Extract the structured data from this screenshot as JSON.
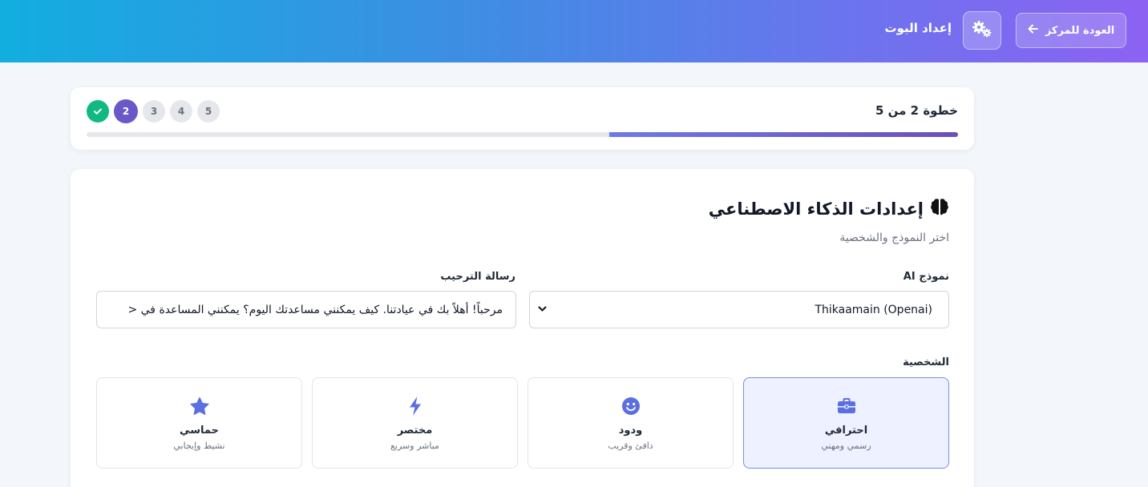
{
  "header": {
    "back_label": "العودة للمركز",
    "title": "إعداد البوت",
    "back_icon": "arrow-right-icon",
    "settings_icon": "gears-icon"
  },
  "progress": {
    "step_text": "خطوة 2 من 5",
    "current_step": 2,
    "total_steps": 5,
    "fraction": 0.4,
    "steps": [
      "✓",
      "2",
      "3",
      "4",
      "5"
    ]
  },
  "ai_settings": {
    "title": "إعدادات الذكاء الاصطناعي",
    "title_icon": "brain-icon",
    "subtitle": "اختر النموذج والشخصية",
    "model_label": "نموذج AI",
    "model_value": "Thikaamain (Openai)",
    "welcome_label": "رسالة الترحيب",
    "welcome_value": "مرحباً! أهلاً بك في عيادتنا. كيف يمكنني مساعدتك اليوم؟ يمكنني المساعدة في <",
    "personality_label": "الشخصية",
    "personalities": [
      {
        "name": "احترافي",
        "desc": "رسمي ومهني",
        "icon": "briefcase-icon",
        "selected": true
      },
      {
        "name": "ودود",
        "desc": "دافئ وقريب",
        "icon": "smile-icon",
        "selected": false
      },
      {
        "name": "مختصر",
        "desc": "مباشر وسريع",
        "icon": "bolt-icon",
        "selected": false
      },
      {
        "name": "حماسي",
        "desc": "نشيط وإيجابي",
        "icon": "star-icon",
        "selected": false
      }
    ]
  },
  "colors": {
    "accent": "#6d7be6",
    "success": "#10b981",
    "current_step": "#6a58c9",
    "icon_blue": "#5b6fe0"
  }
}
